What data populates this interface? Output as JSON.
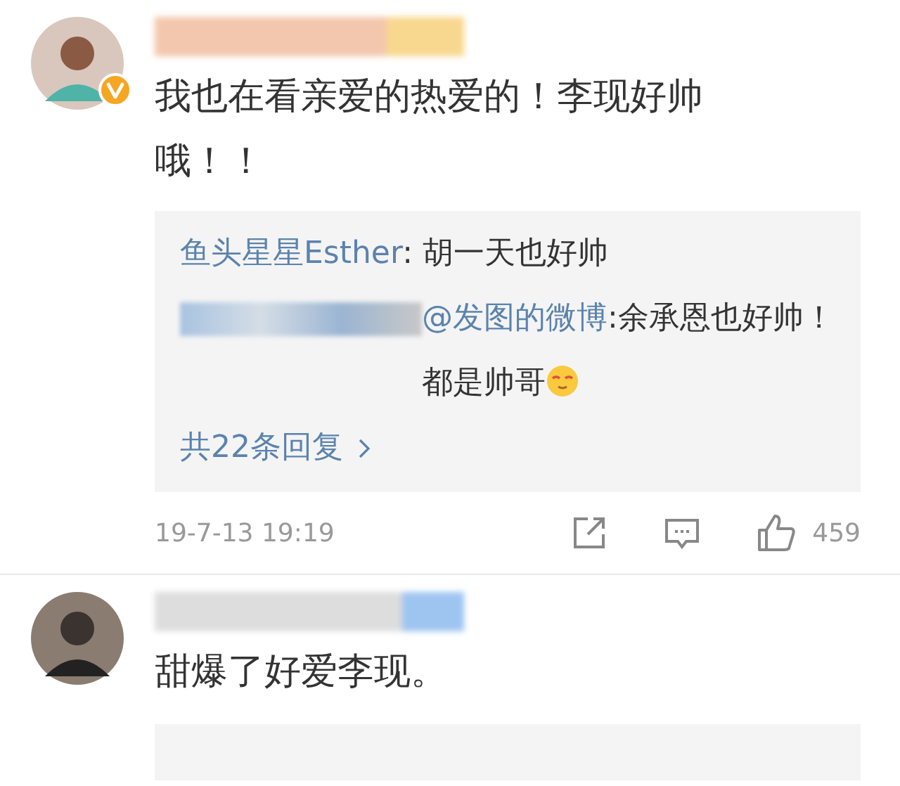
{
  "comments": [
    {
      "verified": true,
      "text": "我也在看亲爱的热爱的！李现好帅哦！！",
      "replies": [
        {
          "kind": "named",
          "author": "鱼头星星Esther",
          "text": ": 胡一天也好帅"
        },
        {
          "kind": "hidden_author",
          "mention": "@发图的微博",
          "text": ":余承恩也好帅！都是帅哥"
        }
      ],
      "reply_count": "共22条回复",
      "time": "19-7-13 19:19",
      "likes": "459"
    },
    {
      "verified": false,
      "text": "甜爆了好爱李现。",
      "reply_box": true
    }
  ]
}
